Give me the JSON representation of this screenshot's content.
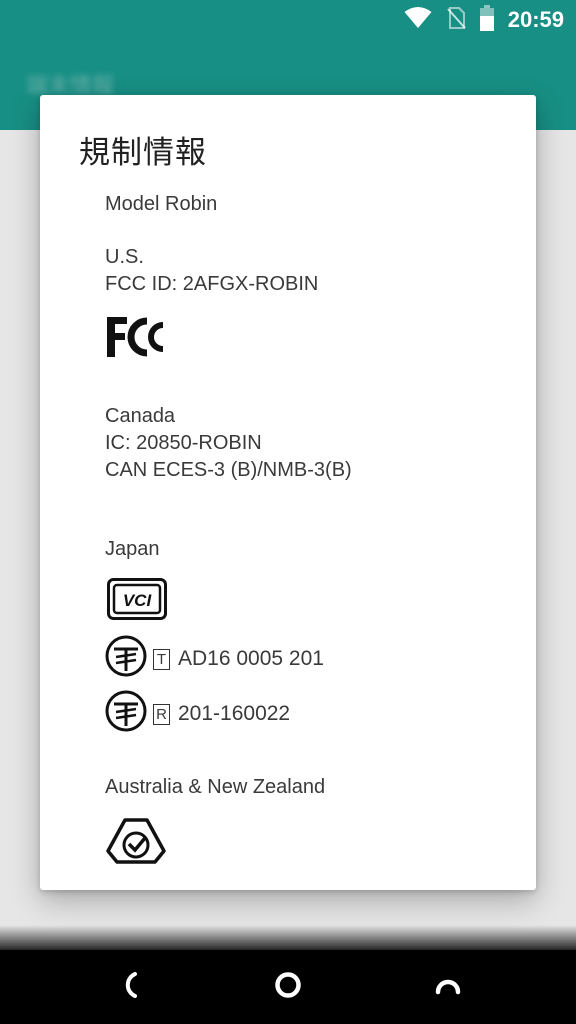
{
  "status_bar": {
    "time": "20:59",
    "icons": [
      "wifi-icon",
      "no-sim-icon",
      "battery-icon"
    ]
  },
  "app": {
    "title": "端末情報"
  },
  "dialog": {
    "title": "規制情報",
    "model": "Model Robin",
    "us": {
      "heading": "U.S.",
      "fcc_id": "FCC ID: 2AFGX-ROBIN",
      "logo": "FC"
    },
    "canada": {
      "heading": "Canada",
      "ic": "IC: 20850-ROBIN",
      "ces": "CAN ECES-3 (B)/NMB-3(B)"
    },
    "japan": {
      "heading": "Japan",
      "vcci_logo": "VCI",
      "telecom_letter": "T",
      "telecom_number": "AD16 0005 201",
      "radio_letter": "R",
      "radio_number": "201-160022"
    },
    "anz": {
      "heading": "Australia & New Zealand"
    }
  },
  "nav_bar": {
    "buttons": [
      "back-icon",
      "home-icon",
      "recents-icon"
    ]
  },
  "colors": {
    "app_bar": "#1a978c",
    "dialog_bg": "#ffffff",
    "text": "#3a3a3a",
    "nav_bar": "#000000"
  }
}
